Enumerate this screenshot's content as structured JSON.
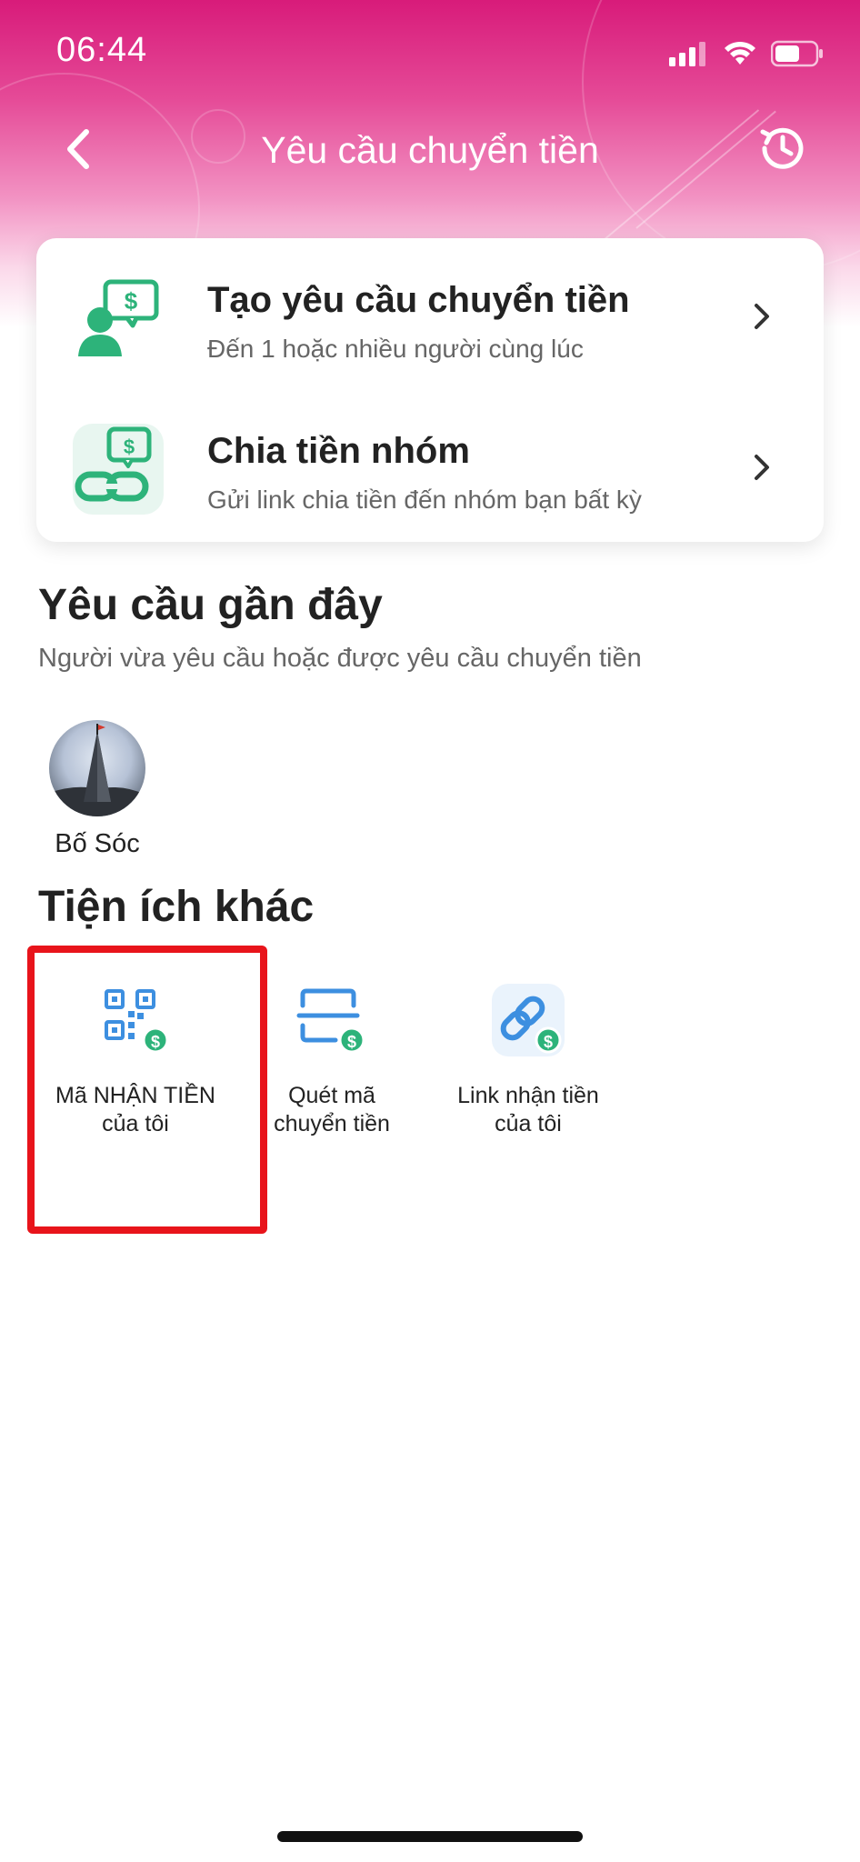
{
  "status_bar": {
    "time": "06:44"
  },
  "nav": {
    "title": "Yêu cầu chuyển tiền"
  },
  "actions": [
    {
      "title": "Tạo yêu cầu chuyển tiền",
      "subtitle": "Đến 1 hoặc nhiều người cùng lúc",
      "icon": "person-money-request-icon"
    },
    {
      "title": "Chia tiền nhóm",
      "subtitle": "Gửi link chia tiền đến nhóm bạn bất kỳ",
      "icon": "link-money-split-icon"
    }
  ],
  "recent": {
    "title": "Yêu cầu gần đây",
    "subtitle": "Người vừa yêu cầu hoặc được yêu cầu chuyển tiền",
    "contacts": [
      {
        "name": "Bố Sóc"
      }
    ]
  },
  "utilities": {
    "title": "Tiện ích khác",
    "items": [
      {
        "label_line1": "Mã NHẬN TIỀN",
        "label_line2": "của tôi",
        "icon": "qr-code-money-icon"
      },
      {
        "label_line1": "Quét mã",
        "label_line2": "chuyển tiền",
        "icon": "scan-money-icon"
      },
      {
        "label_line1": "Link nhận tiền",
        "label_line2": "của tôi",
        "icon": "link-money-icon"
      }
    ]
  },
  "colors": {
    "header_pink": "#d81b7a",
    "icon_green": "#2db37a",
    "icon_blue": "#3d8fe0",
    "highlight_red": "#e8141b"
  }
}
